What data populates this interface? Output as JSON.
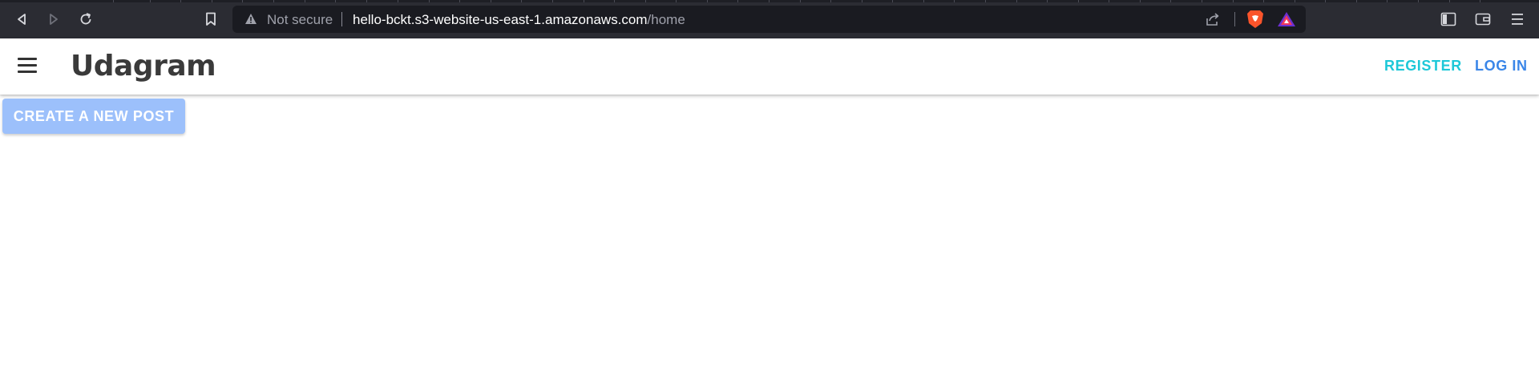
{
  "browser": {
    "security_text": "Not secure",
    "url_host": "hello-bckt.s3-website-us-east-1.amazonaws.com",
    "url_path": "/home",
    "icons": [
      "back-icon",
      "forward-icon",
      "reload-icon",
      "bookmark-icon",
      "warning-icon",
      "share-icon",
      "brave-shield-icon",
      "brave-rewards-icon",
      "sidebar-icon",
      "wallet-icon",
      "menu-icon"
    ]
  },
  "app": {
    "title": "Udagram",
    "nav": {
      "register": "REGISTER",
      "login": "LOG IN"
    },
    "create_post_label": "CREATE A NEW POST",
    "colors": {
      "register": "#1ec8d8",
      "login": "#3a86e8",
      "create_button": "#9cc0fb"
    }
  }
}
